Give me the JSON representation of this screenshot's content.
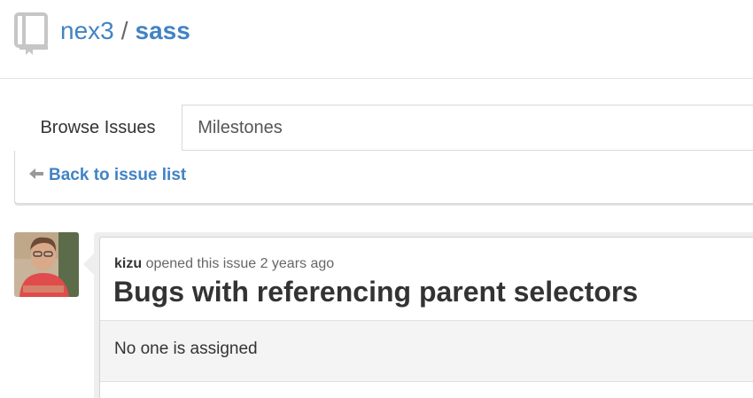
{
  "repo": {
    "owner": "nex3",
    "separator": "/",
    "name": "sass",
    "icon": "repo-book-icon"
  },
  "tabs": [
    {
      "label": "Browse Issues",
      "active": true
    },
    {
      "label": "Milestones",
      "active": false
    }
  ],
  "back_link": {
    "label": "Back to issue list",
    "icon": "left-arrow-icon"
  },
  "issue": {
    "author": "kizu",
    "opened_text": "opened this issue",
    "time_ago": "2 years ago",
    "title": "Bugs with referencing parent selectors",
    "assignee_text": "No one is assigned"
  },
  "colors": {
    "link": "#4183c4",
    "text": "#333333",
    "muted": "#666666",
    "border": "#d8d8d8",
    "panel": "#eeeeee"
  }
}
